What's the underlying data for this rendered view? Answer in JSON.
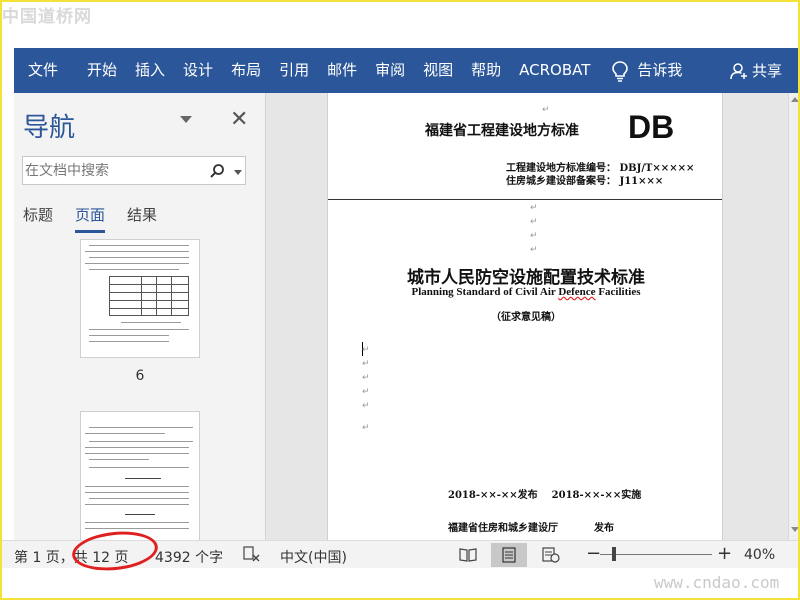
{
  "watermark": {
    "top": "中国道桥网",
    "bottom": "www.cndao.com"
  },
  "ribbon": {
    "tabs": [
      "文件",
      "开始",
      "插入",
      "设计",
      "布局",
      "引用",
      "邮件",
      "审阅",
      "视图",
      "帮助",
      "ACROBAT"
    ],
    "tell_me": "告诉我",
    "share": "共享",
    "color": "#2b579a"
  },
  "nav": {
    "title": "导航",
    "search_placeholder": "在文档中搜索",
    "tabs": [
      "标题",
      "页面",
      "结果"
    ],
    "active_tab": "页面",
    "thumb_page_number": "6"
  },
  "document": {
    "provincial_standard": "福建省工程建设地方标准",
    "db_mark": "DB",
    "code_line1": "工程建设地方标准编号： DBJ/T×××××",
    "code_line2": "住房城乡建设部备案号： J11×××",
    "title_cn": "城市人民防空设施配置技术标准",
    "title_en_part1": "Planning Standard of Civil Air ",
    "title_en_part2": "Defence",
    "title_en_part3": " Facilities",
    "draft_note": "（征求意见稿）",
    "publish_date": "2018-××-××发布",
    "effective_date": "2018-××-××实施",
    "issuer": "福建省住房和城乡建设厅",
    "issue_label": "发布",
    "paragraph_mark": "↵"
  },
  "status_bar": {
    "page_info": "第 1 页，共 12 页",
    "word_count": "4392 个字",
    "language": "中文(中国)",
    "zoom": "40%",
    "zoom_level_fraction": 0.1
  },
  "annotation": {
    "ellipse_color": "#e02020"
  }
}
